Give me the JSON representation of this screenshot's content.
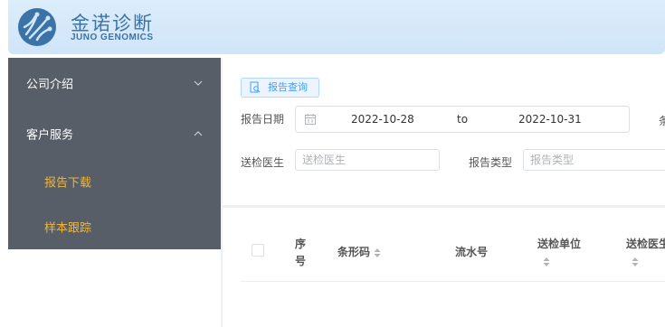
{
  "header": {
    "logo_cn": "金诺诊断",
    "logo_en": "JUNO GENOMICS",
    "logo_icon": "juno-logo-icon"
  },
  "sidebar": {
    "items": [
      {
        "label": "公司介绍",
        "icon": "chevron-down-icon",
        "expanded": false
      },
      {
        "label": "客户服务",
        "icon": "chevron-up-icon",
        "expanded": true,
        "children": [
          {
            "label": "报告下载"
          },
          {
            "label": "样本跟踪"
          }
        ]
      }
    ],
    "colors": {
      "background": "#575e68",
      "text": "#ffffff",
      "sub_text": "#f0b63c"
    }
  },
  "query": {
    "tab_label": "报告查询",
    "tab_icon": "report-search-icon",
    "report_date_label": "报告日期",
    "date_start": "2022-10-28",
    "date_separator": "to",
    "date_end": "2022-10-31",
    "truncated_label": "条",
    "doctor_label": "送检医生",
    "doctor_placeholder": "送检医生",
    "report_type_label": "报告类型",
    "report_type_placeholder": "报告类型"
  },
  "table": {
    "columns": [
      {
        "label_line1": "序",
        "label_line2": "号"
      },
      {
        "label": "条形码",
        "sortable": true
      },
      {
        "label": "流水号"
      },
      {
        "label": "送检单位",
        "sortable": true
      },
      {
        "label": "送检医生",
        "sortable": true
      }
    ]
  },
  "accent": "#409eff"
}
